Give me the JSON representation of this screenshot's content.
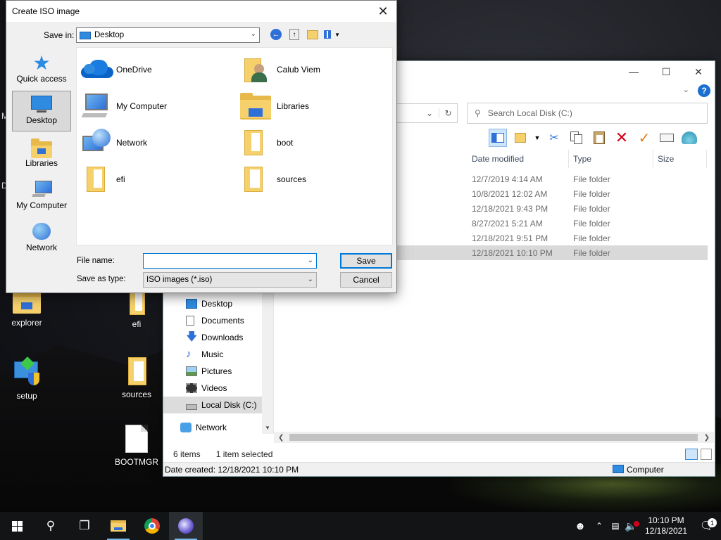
{
  "dialog": {
    "title": "Create ISO image",
    "save_in_label": "Save in:",
    "save_in_value": "Desktop",
    "places": [
      {
        "label": "Quick access"
      },
      {
        "label": "Desktop"
      },
      {
        "label": "Libraries"
      },
      {
        "label": "My Computer"
      },
      {
        "label": "Network"
      }
    ],
    "items": [
      {
        "label": "OneDrive"
      },
      {
        "label": "Calub Viem"
      },
      {
        "label": "My Computer"
      },
      {
        "label": "Libraries"
      },
      {
        "label": "Network"
      },
      {
        "label": "boot"
      },
      {
        "label": "efi"
      },
      {
        "label": "sources"
      }
    ],
    "file_name_label": "File name:",
    "file_name_value": "",
    "save_type_label": "Save as type:",
    "save_type_value": "ISO images (*.iso)",
    "save_button": "Save",
    "cancel_button": "Cancel"
  },
  "explorer": {
    "search_placeholder": "Search Local Disk (C:)",
    "columns": {
      "date": "Date modified",
      "type": "Type",
      "size": "Size"
    },
    "rows": [
      {
        "date": "12/7/2019 4:14 AM",
        "type": "File folder"
      },
      {
        "date": "10/8/2021 12:02 AM",
        "type": "File folder"
      },
      {
        "date": "12/18/2021 9:43 PM",
        "type": "File folder"
      },
      {
        "date": "8/27/2021 5:21 AM",
        "type": "File folder"
      },
      {
        "date": "12/18/2021 9:51 PM",
        "type": "File folder"
      },
      {
        "date": "12/18/2021 10:10 PM",
        "type": "File folder"
      }
    ],
    "nav": [
      {
        "label": "Desktop"
      },
      {
        "label": "Documents"
      },
      {
        "label": "Downloads"
      },
      {
        "label": "Music"
      },
      {
        "label": "Pictures"
      },
      {
        "label": "Videos"
      },
      {
        "label": "Local Disk (C:)"
      },
      {
        "label": "Network"
      }
    ],
    "status_items": "6 items",
    "status_selected": "1 item selected",
    "date_created": "Date created: 12/18/2021 10:10 PM",
    "computer_label": "Computer"
  },
  "desktop": {
    "icons": [
      {
        "label": "explorer"
      },
      {
        "label": "efi"
      },
      {
        "label": "setup"
      },
      {
        "label": "sources"
      },
      {
        "label": "BOOTMGR"
      }
    ]
  },
  "taskbar": {
    "time": "10:10 PM",
    "date": "12/18/2021",
    "notification_count": "1"
  },
  "colors": {
    "accent": "#0078d7",
    "folder": "#f6d16b",
    "delete": "#d0021b",
    "check": "#e07b1a"
  }
}
